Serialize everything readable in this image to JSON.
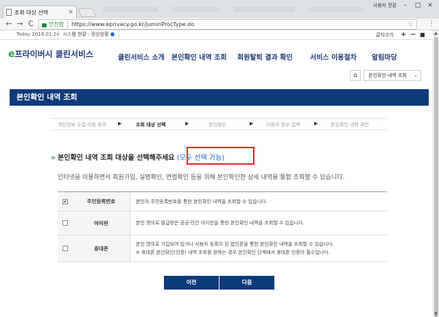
{
  "browser": {
    "tab_title": "조회 대상 선택",
    "tab_close": "×",
    "profile_label": "사용자 전환",
    "win_minimize": "–",
    "win_maximize": "□",
    "win_close": "×",
    "back": "←",
    "forward": "→",
    "reload": "C",
    "secure_label": "안전함",
    "url": "https://www.eprivacy.go.kr/juminProcType.do",
    "star": "☆",
    "menu": "⋮"
  },
  "topbar": {
    "today": "Today 2018.01.24",
    "system_status": "시스템 현황 : 정상원활",
    "font_size_label": "글자크기",
    "zoom_in": "+",
    "zoom_reset": "−",
    "zoom_out": "■"
  },
  "header": {
    "logo_e": "e",
    "logo_text": "프라이버시 클린서비스",
    "nav": [
      "클린서비스 소개",
      "본인확인 내역 조회",
      "회원탈퇴 결과 확인",
      "서비스 이용절차",
      "알림마당"
    ]
  },
  "location": {
    "home_icon": "⌂",
    "current": "본인확인 내역 조회",
    "chevron": "⌄"
  },
  "page_title": "본인확인 내역 조회",
  "steps": [
    {
      "label": "개인정보 수집·이용 동의",
      "active": false
    },
    {
      "label": "조회 대상 선택",
      "active": true
    },
    {
      "label": "본인확인",
      "active": false
    },
    {
      "label": "이용자 정보 입력",
      "active": false
    },
    {
      "label": "본인확인 내역 확인",
      "active": false
    }
  ],
  "step_arrow": "▶",
  "section": {
    "chevrons": "»",
    "heading": "본인확인 내역 조회 대상을 선택해주세요",
    "highlight": "(모두 선택 가능)"
  },
  "description": "인터넷을 이용하면서 회원가입, 실명확인, 연령확인 등을 위해 본인확인한 상세 내역을 통합 조회할 수 있습니다.",
  "options": [
    {
      "checked": true,
      "mark": "✔",
      "name": "주민등록번호",
      "desc": [
        "본인의 주민등록번호를 통한 본인확인 내역을 조회할 수 있습니다."
      ]
    },
    {
      "checked": false,
      "mark": "",
      "name": "아이핀",
      "desc": [
        "본인 명의로 발급받은 공공·민간 아이핀을 통한 본인확인 내역을 조회할 수 있습니다."
      ]
    },
    {
      "checked": false,
      "mark": "",
      "name": "휴대폰",
      "desc": [
        "본인 명의로 가입되어 있거나 사용자 등록이 된 법인폰을 통한 본인확인 내역을 조회할 수 있습니다.",
        "※ 휴대폰 본인확인(인증) 내역 조회를 원하는 경우 본인확인 단계에서 휴대폰 인증이 필수입니다."
      ]
    }
  ],
  "buttons": {
    "prev": "이전",
    "next": "다음"
  },
  "scrollbar": {
    "up": "▲",
    "down": "▼"
  },
  "colors": {
    "navy": "#0c3a7a",
    "accent_green": "#2a9d3a",
    "link_blue": "#1a5fc1",
    "highlight_red": "#e52020"
  }
}
